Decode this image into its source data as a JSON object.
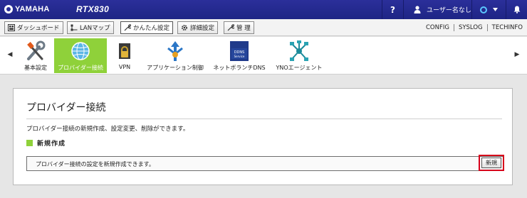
{
  "topbar": {
    "brand": "YAMAHA",
    "model": "RTX830",
    "help": "?",
    "user": "ユーザー名なし"
  },
  "nav": {
    "tabs": [
      {
        "label": "ダッシュボード"
      },
      {
        "label": "LANマップ"
      },
      {
        "label": "かんたん設定"
      },
      {
        "label": "詳細設定"
      },
      {
        "label": "管 理"
      }
    ],
    "active_tab": "かんたん設定",
    "right_links": [
      "CONFIG",
      "SYSLOG",
      "TECHINFO"
    ]
  },
  "menu": {
    "items": [
      {
        "label": "基本設定",
        "icon": "tools-icon"
      },
      {
        "label": "プロバイダー接続",
        "icon": "globe-icon",
        "selected": true
      },
      {
        "label": "VPN",
        "icon": "vpn-lock-icon"
      },
      {
        "label": "アプリケーション制御",
        "icon": "app-control-icon"
      },
      {
        "label": "ネットボランチDNS",
        "icon": "ddns-service-icon"
      },
      {
        "label": "YNOエージェント",
        "icon": "yno-network-icon"
      }
    ]
  },
  "page": {
    "title": "プロバイダー接続",
    "description": "プロバイダー接続の新規作成、設定変更、削除ができます。",
    "section_title": "新規作成",
    "row_text": "プロバイダー接続の設定を新規作成できます。",
    "new_button": "新規"
  },
  "colors": {
    "header_blue": "#2b2f9a",
    "accent_green": "#8fd13a",
    "highlight_red": "#d7001b"
  }
}
